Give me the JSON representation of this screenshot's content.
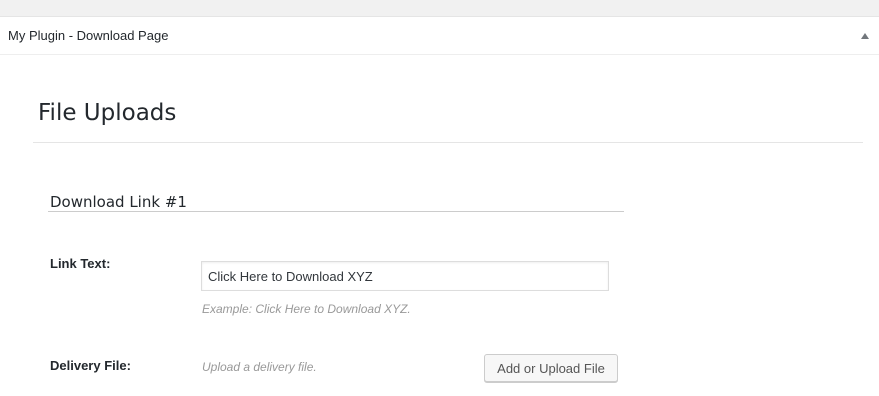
{
  "postbox": {
    "title": "My Plugin - Download Page",
    "toggle_icon": "triangle-up-icon"
  },
  "section": {
    "title": "File Uploads"
  },
  "subsection": {
    "title": "Download Link #1"
  },
  "fields": {
    "link_text": {
      "label": "Link Text:",
      "value": "Click Here to Download XYZ",
      "description": "Example: Click Here to Download XYZ."
    },
    "delivery_file": {
      "label": "Delivery File:",
      "description": "Upload a delivery file.",
      "button_label": "Add or Upload File"
    }
  },
  "colors": {
    "text": "#23282d",
    "muted": "#999999",
    "divider": "#e5e5e5",
    "toggle": "#72777c"
  }
}
